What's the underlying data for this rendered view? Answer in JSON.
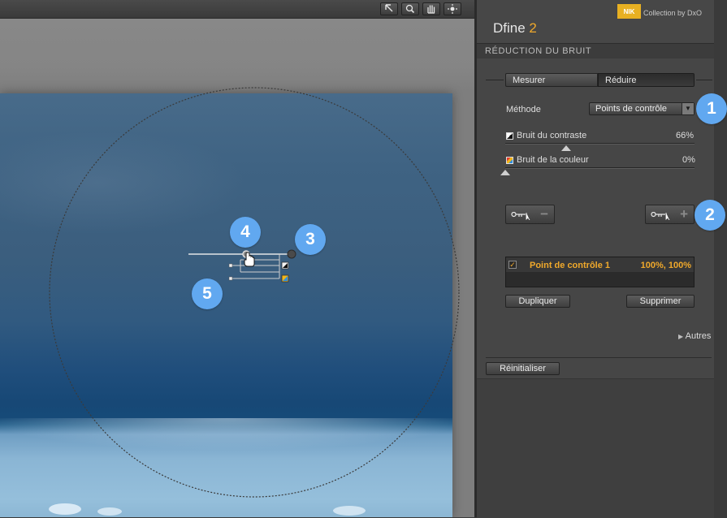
{
  "toolbar": {
    "tools": [
      {
        "name": "select-tool",
        "glyph": "↖"
      },
      {
        "name": "zoom-tool",
        "glyph": "🔍"
      },
      {
        "name": "hand-tool",
        "glyph": "✋"
      },
      {
        "name": "preview-tool",
        "glyph": "✦"
      }
    ]
  },
  "callouts": [
    "1",
    "2",
    "3",
    "4",
    "5"
  ],
  "panel": {
    "brand_logo": "NIK",
    "brand_text": "Collection by DxO",
    "product_name": "Dfine",
    "product_version": "2",
    "section_title": "RÉDUCTION DU BRUIT",
    "mode_tabs": {
      "measure": "Mesurer",
      "reduce": "Réduire",
      "active": "Réduire"
    },
    "method": {
      "label": "Méthode",
      "value": "Points de contrôle"
    },
    "sliders": [
      {
        "label": "Bruit du contraste",
        "value_text": "66%",
        "value": 0.66
      },
      {
        "label": "Bruit de la couleur",
        "value_text": "0%",
        "value": 0.0
      }
    ],
    "control_points": [
      {
        "name": "Point de contrôle 1",
        "values": "100%, 100%",
        "checked": true
      }
    ],
    "buttons": {
      "duplicate": "Dupliquer",
      "delete": "Supprimer",
      "more": "Autres",
      "reset": "Réinitialiser"
    }
  },
  "colors": {
    "accent_orange": "#f0a92b",
    "callout_blue": "#61a8f0",
    "panel_bg": "#4a4a4a",
    "sky_dark": "#174876"
  },
  "icons": [
    "select-arrow-icon",
    "zoom-icon",
    "hand-icon",
    "preview-icon",
    "key-minus-icon",
    "key-plus-icon",
    "chevron-down-icon",
    "triangle-right-icon"
  ]
}
